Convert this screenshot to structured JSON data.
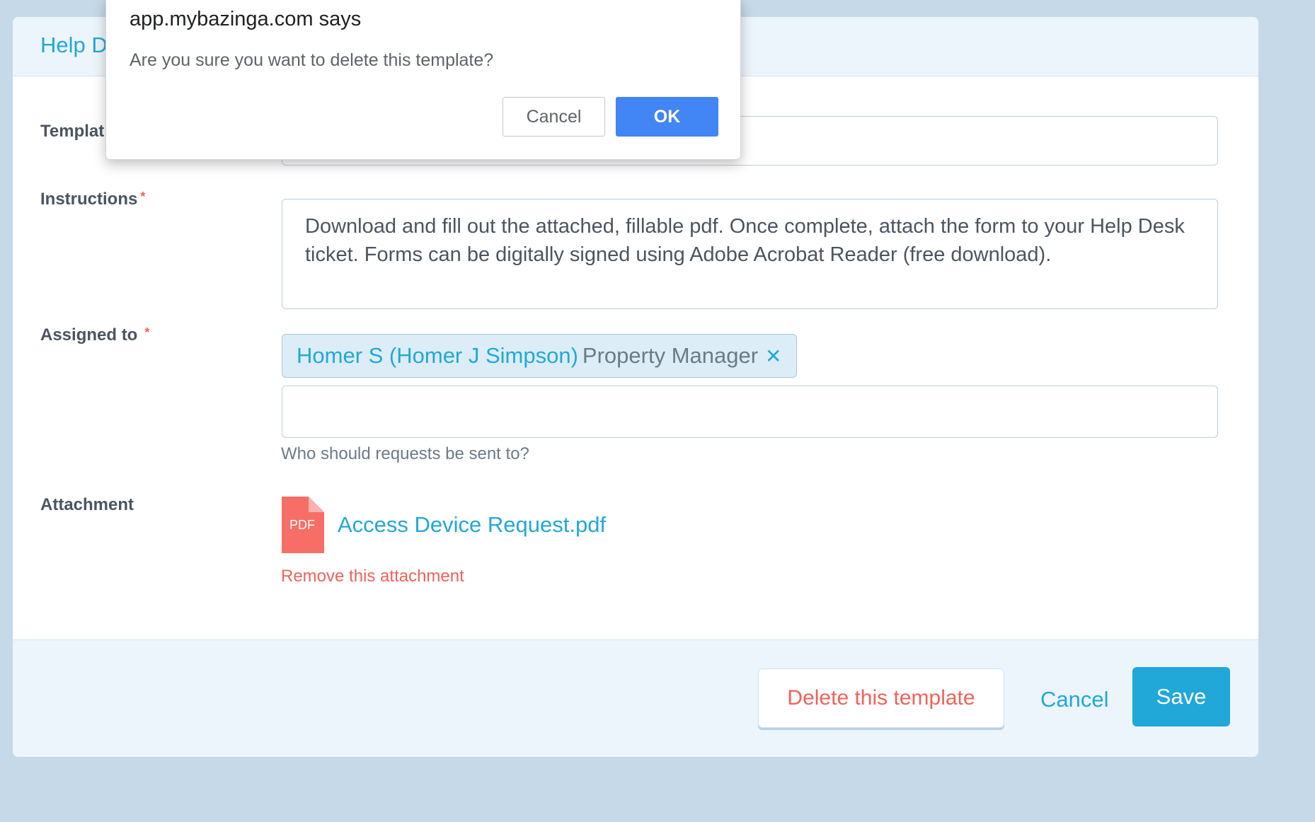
{
  "card": {
    "title": "Help D",
    "fields": {
      "template_label": "Templat",
      "instructions_label": "Instructions",
      "instructions_required": "*",
      "instructions_value": "Download and fill out the attached, fillable pdf.  Once complete, attach the form to your Help Desk ticket. Forms can be digitally signed using Adobe Acrobat Reader (free download).",
      "assigned_label": "Assigned to",
      "assigned_required": "*",
      "assigned_tag": {
        "name": "Homer S (Homer J Simpson)",
        "role": "Property Manager",
        "remove_glyph": "✕"
      },
      "assigned_input_value": "",
      "assigned_hint": "Who should requests be sent to?",
      "attachment_label": "Attachment",
      "attachment_icon_label": "PDF",
      "attachment_name": "Access Device Request.pdf",
      "remove_attachment": "Remove this attachment"
    },
    "footer": {
      "delete_label": "Delete this template",
      "cancel_label": "Cancel",
      "save_label": "Save"
    }
  },
  "dialog": {
    "title": "app.mybazinga.com says",
    "message": "Are you sure you want to delete this template?",
    "cancel_label": "Cancel",
    "ok_label": "OK"
  },
  "colors": {
    "accent": "#21a8d8",
    "danger": "#f0625a",
    "dialog_ok": "#4285f4",
    "background": "#c5d9e8"
  }
}
